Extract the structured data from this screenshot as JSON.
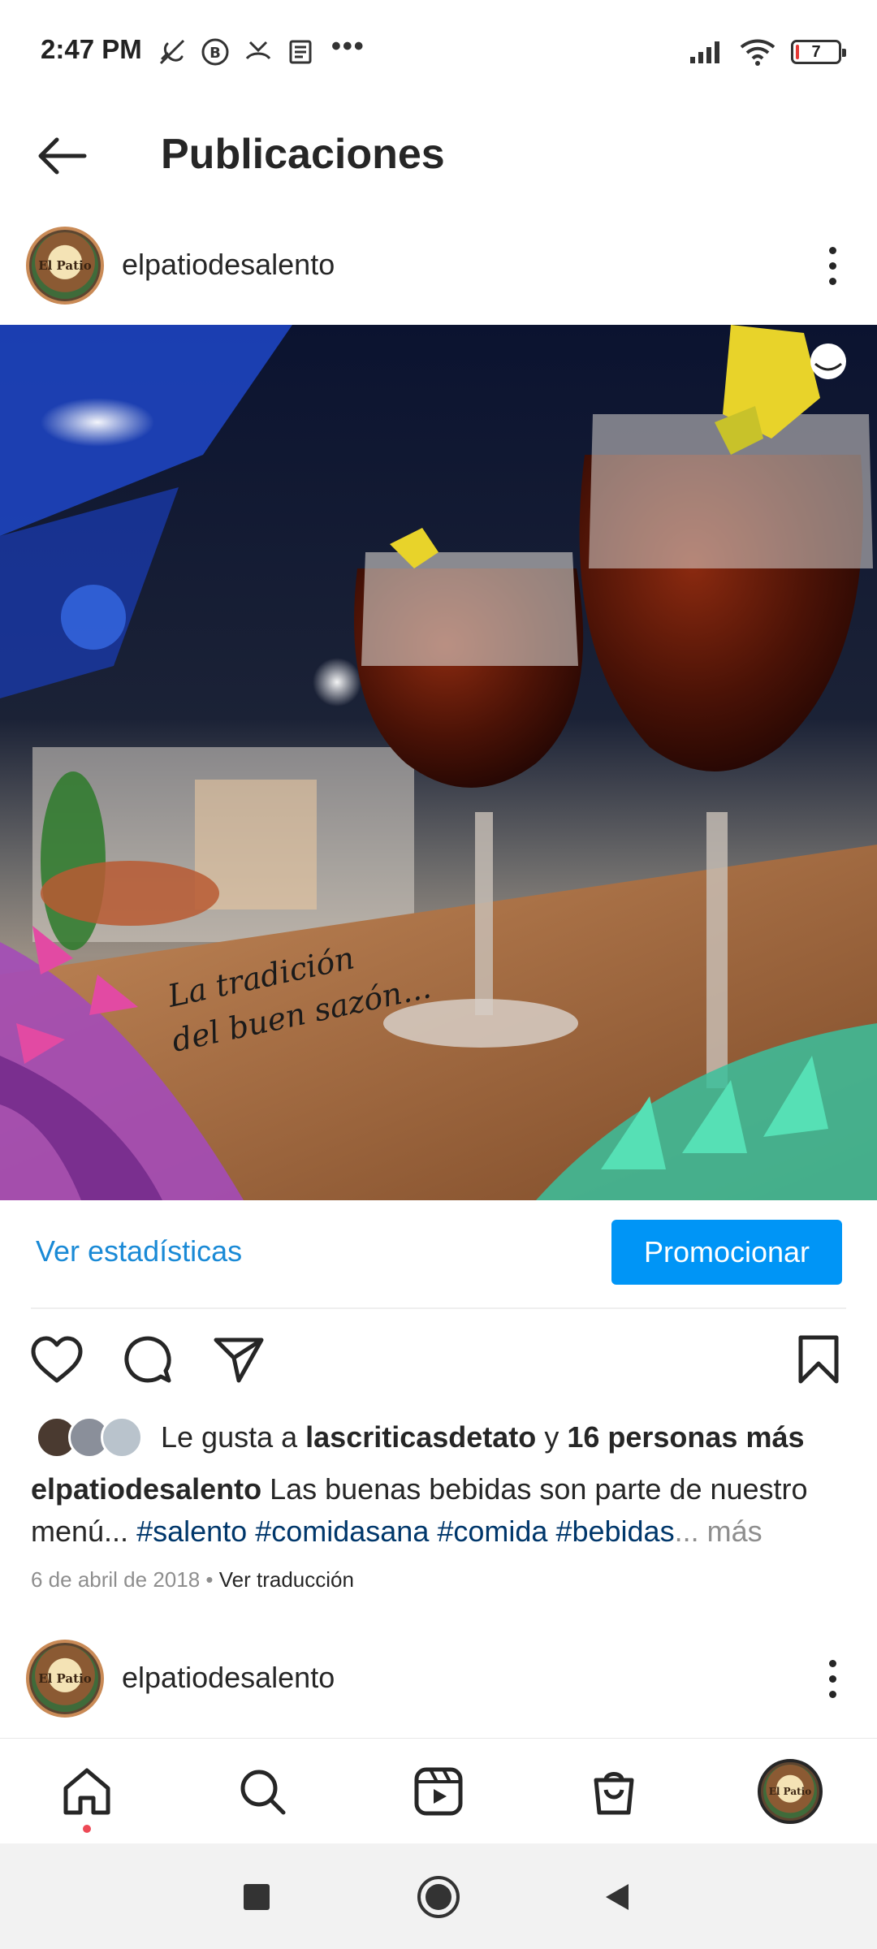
{
  "status_bar": {
    "time": "2:47 PM",
    "overflow": "•••",
    "battery_level": "7",
    "battery_fraction": 0.07,
    "icons": [
      "no-call-icon",
      "b-badge-icon",
      "missed-call-icon",
      "news-icon",
      "signal-icon",
      "wifi-icon",
      "battery-icon"
    ]
  },
  "header": {
    "title": "Publicaciones"
  },
  "post": {
    "username": "elpatiodesalento",
    "avatar_text": "El Patio",
    "image_overlay_text_line1": "La tradición",
    "image_overlay_text_line2": "del buen sazón...",
    "stats_link": "Ver estadísticas",
    "promote_button": "Promocionar",
    "likes": {
      "prefix": "Le gusta a",
      "user": "lascriticasdetato",
      "connector": "y",
      "others": "16 personas más"
    },
    "caption": {
      "username": "elpatiodesalento",
      "text": "Las buenas bebidas son parte de nuestro menú...",
      "hashtags": [
        "#salento",
        "#comidasana",
        "#comida",
        "#bebidas"
      ],
      "ellipsis": "...",
      "more": "más"
    },
    "date": "6 de abril de 2018",
    "separator": "•",
    "translate": "Ver traducción"
  },
  "next_post": {
    "username": "elpatiodesalento"
  },
  "bottom_nav": {
    "items": [
      "home-icon",
      "search-icon",
      "reels-icon",
      "shop-icon",
      "profile-avatar"
    ],
    "active": "home-icon"
  },
  "colors": {
    "link_blue": "#1a8ad6",
    "button_blue": "#0095f6",
    "hashtag_blue": "#00376b",
    "muted_gray": "#8e8e8e",
    "notification_red": "#ed4956"
  }
}
